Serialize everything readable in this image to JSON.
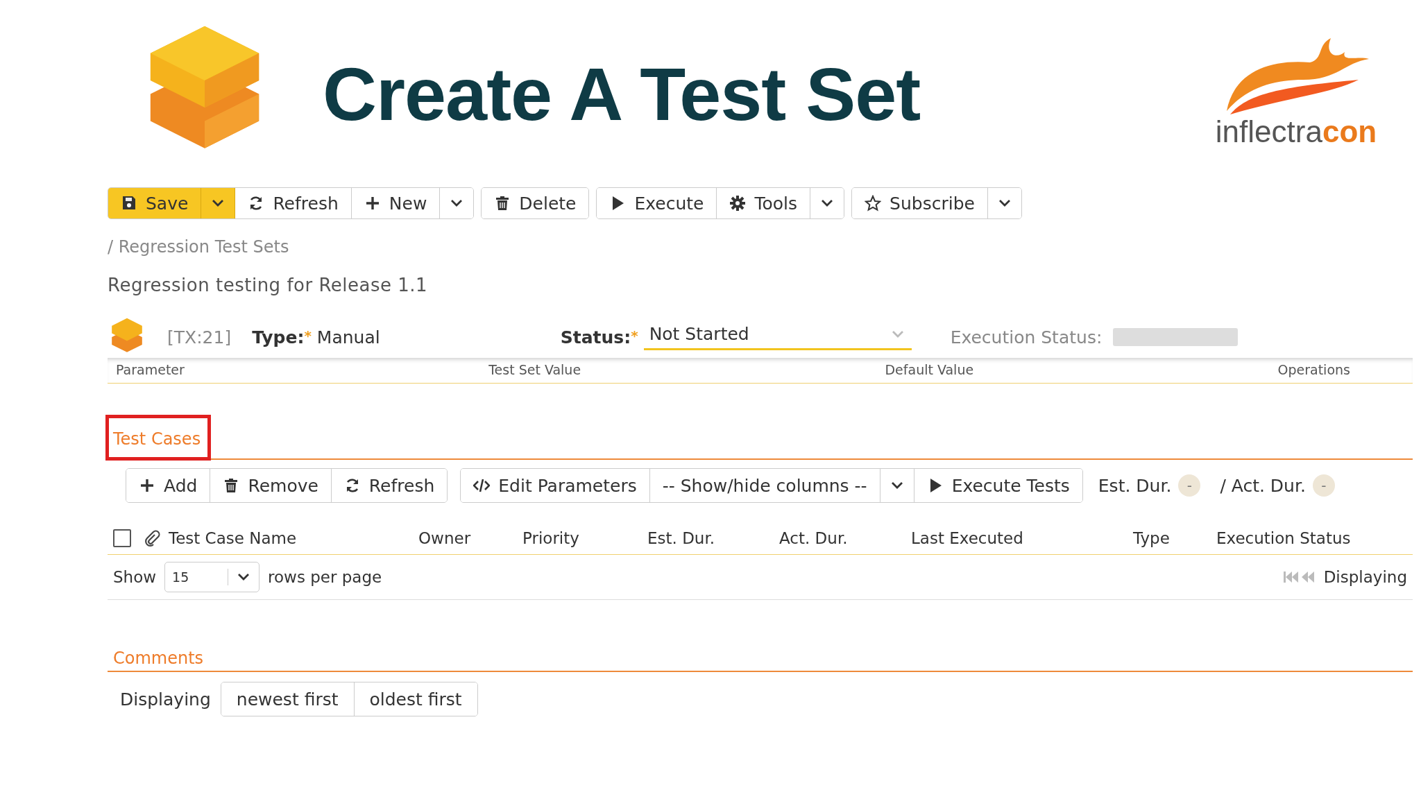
{
  "header": {
    "title": "Create A Test Set",
    "logo": {
      "left": "inflectra",
      "right": "con"
    }
  },
  "toolbar": {
    "groups": [
      [
        {
          "kind": "save",
          "label": "Save",
          "primary": true
        },
        {
          "kind": "caret",
          "primary": true
        },
        {
          "kind": "refresh",
          "label": "Refresh",
          "primary": false
        },
        {
          "kind": "new",
          "label": "New",
          "primary": false
        },
        {
          "kind": "caret",
          "primary": false
        }
      ],
      [
        {
          "kind": "delete",
          "label": "Delete",
          "primary": false
        }
      ],
      [
        {
          "kind": "execute",
          "label": "Execute",
          "primary": false
        },
        {
          "kind": "tools",
          "label": "Tools",
          "primary": false
        },
        {
          "kind": "caret",
          "primary": false
        }
      ],
      [
        {
          "kind": "subscribe",
          "label": "Subscribe",
          "primary": false
        },
        {
          "kind": "caret",
          "primary": false
        }
      ]
    ]
  },
  "breadcrumb": {
    "separator": "/",
    "label": "Regression Test Sets"
  },
  "description": "Regression testing for Release 1.1",
  "info": {
    "id": "[TX:21]",
    "type_label": "Type:",
    "required_mark": "*",
    "type_value": "Manual",
    "status_label": "Status:",
    "status_required_mark": "*",
    "status_value": "Not Started",
    "execution_label": "Execution Status:"
  },
  "parameters": {
    "columns": [
      "Parameter",
      "Test Set Value",
      "Default Value",
      "Operations"
    ]
  },
  "test_cases": {
    "heading": "Test Cases",
    "highlighted": true,
    "toolbar": {
      "groups": [
        [
          {
            "kind": "new",
            "label": "Add"
          },
          {
            "kind": "delete",
            "label": "Remove"
          },
          {
            "kind": "refresh",
            "label": "Refresh"
          }
        ],
        [
          {
            "kind": "code",
            "label": "Edit Parameters"
          },
          {
            "kind": "select",
            "label": "-- Show/hide columns --"
          },
          {
            "kind": "caret"
          },
          {
            "kind": "execute",
            "label": "Execute Tests"
          }
        ]
      ]
    },
    "est_label": "Est. Dur.",
    "est_value": "-",
    "act_label": "/ Act. Dur.",
    "act_value": "-",
    "select_all": {
      "checked": false
    },
    "columns": [
      "Test Case Name",
      "Owner",
      "Priority",
      "Est. Dur.",
      "Act. Dur.",
      "Last Executed",
      "Type",
      "Execution Status"
    ],
    "pager": {
      "show_label": "Show",
      "rows_value": "15",
      "rows_label": "rows per page",
      "displaying": "Displaying"
    }
  },
  "comments": {
    "heading": "Comments",
    "displaying_label": "Displaying",
    "sort_buttons": [
      "newest first",
      "oldest first"
    ]
  }
}
